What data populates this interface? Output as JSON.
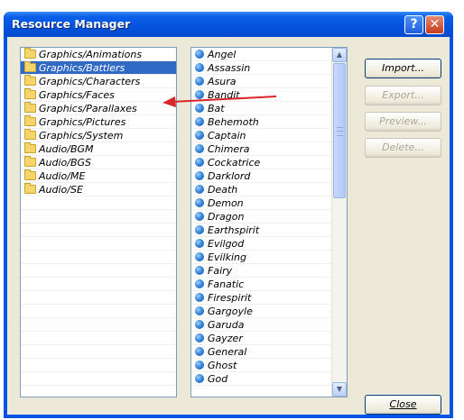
{
  "window": {
    "title": "Resource Manager",
    "help_glyph": "?",
    "close_glyph": "✕"
  },
  "folders": [
    "Graphics/Animations",
    "Graphics/Battlers",
    "Graphics/Characters",
    "Graphics/Faces",
    "Graphics/Parallaxes",
    "Graphics/Pictures",
    "Graphics/System",
    "Audio/BGM",
    "Audio/BGS",
    "Audio/ME",
    "Audio/SE"
  ],
  "selected_folder": "Graphics/Battlers",
  "files": [
    "Angel",
    "Assassin",
    "Asura",
    "Bandit",
    "Bat",
    "Behemoth",
    "Captain",
    "Chimera",
    "Cockatrice",
    "Darklord",
    "Death",
    "Demon",
    "Dragon",
    "Earthspirit",
    "Evilgod",
    "Evilking",
    "Fairy",
    "Fanatic",
    "Firespirit",
    "Gargoyle",
    "Garuda",
    "Gayzer",
    "General",
    "Ghost",
    "God"
  ],
  "buttons": {
    "import": "Import...",
    "export": "Export...",
    "preview": "Preview...",
    "delete": "Delete...",
    "close": "Close"
  },
  "scrollbar": {
    "up_glyph": "▲",
    "down_glyph": "▼"
  },
  "colors": {
    "titlebar": "#0054e3",
    "selection": "#316ac5",
    "annotation_arrow": "#d9262b"
  }
}
